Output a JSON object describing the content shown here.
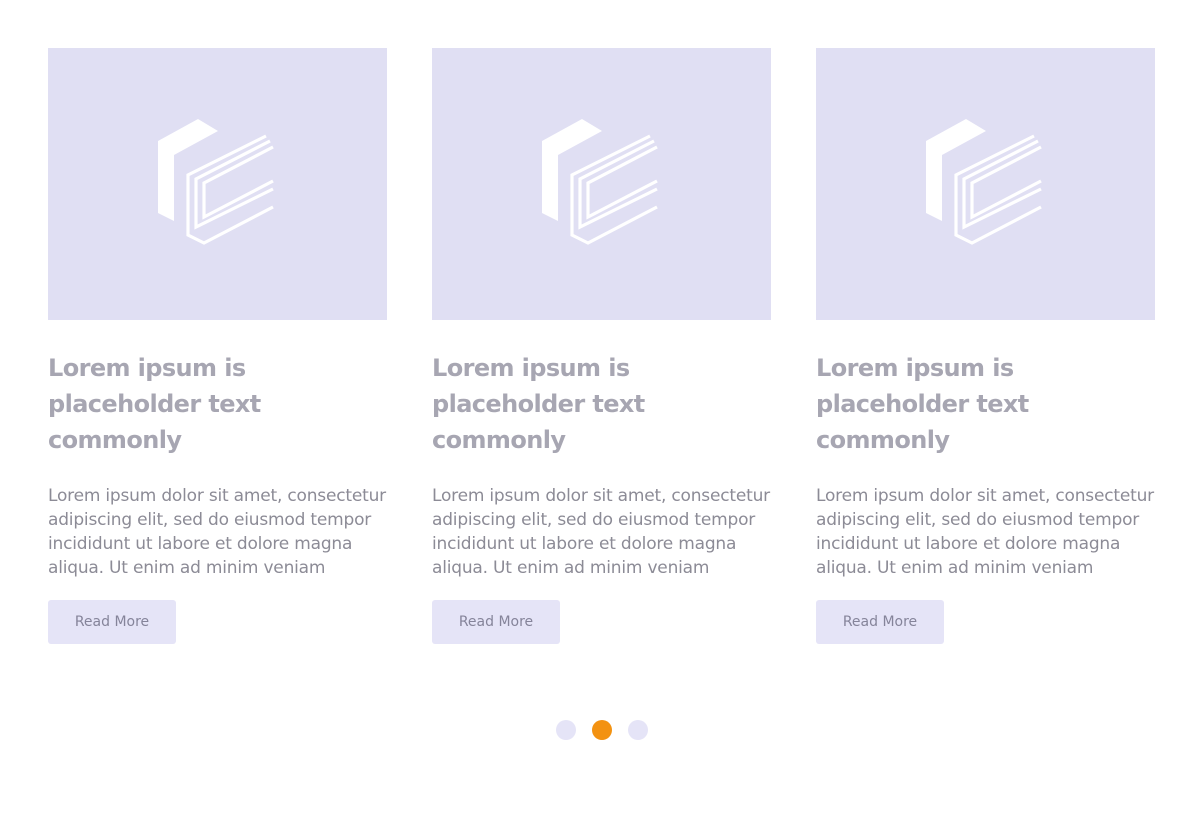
{
  "colors": {
    "image_placeholder_bg": "#e0dff3",
    "title_text": "#a7a6b2",
    "body_text": "#8c8b96",
    "button_bg": "#e5e4f7",
    "dot_inactive": "#e5e4f7",
    "dot_active": "#f39211"
  },
  "cards": [
    {
      "image_icon": "placeholder-logo-icon",
      "title": "Lorem ipsum is placeholder text commonly",
      "body": "Lorem ipsum dolor sit amet, consectetur adipiscing elit, sed do eiusmod tempor incididunt ut labore et dolore magna aliqua. Ut enim ad minim veniam",
      "button_label": "Read More"
    },
    {
      "image_icon": "placeholder-logo-icon",
      "title": "Lorem ipsum is placeholder text commonly",
      "body": "Lorem ipsum dolor sit amet, consectetur adipiscing elit, sed do eiusmod tempor incididunt ut labore et dolore magna aliqua. Ut enim ad minim veniam",
      "button_label": "Read More"
    },
    {
      "image_icon": "placeholder-logo-icon",
      "title": "Lorem ipsum is placeholder text commonly",
      "body": "Lorem ipsum dolor sit amet, consectetur adipiscing elit, sed do eiusmod tempor incididunt ut labore et dolore magna aliqua. Ut enim ad minim veniam",
      "button_label": "Read More"
    }
  ],
  "pagination": {
    "page_count": 3,
    "active_page": 2
  }
}
